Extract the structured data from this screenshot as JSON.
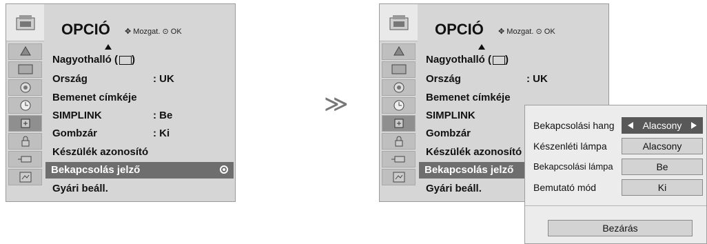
{
  "menu": {
    "title": "OPCIÓ",
    "hint_move": "Mozgat.",
    "hint_ok": "OK",
    "items": [
      {
        "label": "Nagyothalló (",
        "suffix": ")",
        "value": ""
      },
      {
        "label": "Ország",
        "value": ": UK"
      },
      {
        "label": "Bemenet címkéje",
        "value": ""
      },
      {
        "label": "SIMPLINK",
        "value": ": Be"
      },
      {
        "label": "Gombzár",
        "value": ": Ki"
      },
      {
        "label": "Készülék azonosító",
        "value": ""
      },
      {
        "label": "Bekapcsolás jelző",
        "value": ""
      },
      {
        "label": "Gyári beáll.",
        "value": ""
      }
    ],
    "selected_index": 6
  },
  "separator_glyph": "≫",
  "popup": {
    "rows": [
      {
        "label": "Bekapcsolási hang",
        "value": "Alacsony"
      },
      {
        "label": "Készenléti lámpa",
        "value": "Alacsony"
      },
      {
        "label": "Bekapcsolási lámpa",
        "value": "Be"
      },
      {
        "label": "Bemutató mód",
        "value": "Ki"
      }
    ],
    "close_label": "Bezárás"
  },
  "colors": {
    "panel_bg": "#d6d6d6",
    "selection": "#6e6e6e",
    "popup_bg": "#ececec",
    "active_value": "#585858"
  },
  "sidebar_icons": [
    "menu-icon",
    "channel-icon",
    "picture-icon",
    "audio-icon",
    "time-icon",
    "option-icon",
    "lock-icon",
    "input-icon",
    "usb-icon"
  ]
}
